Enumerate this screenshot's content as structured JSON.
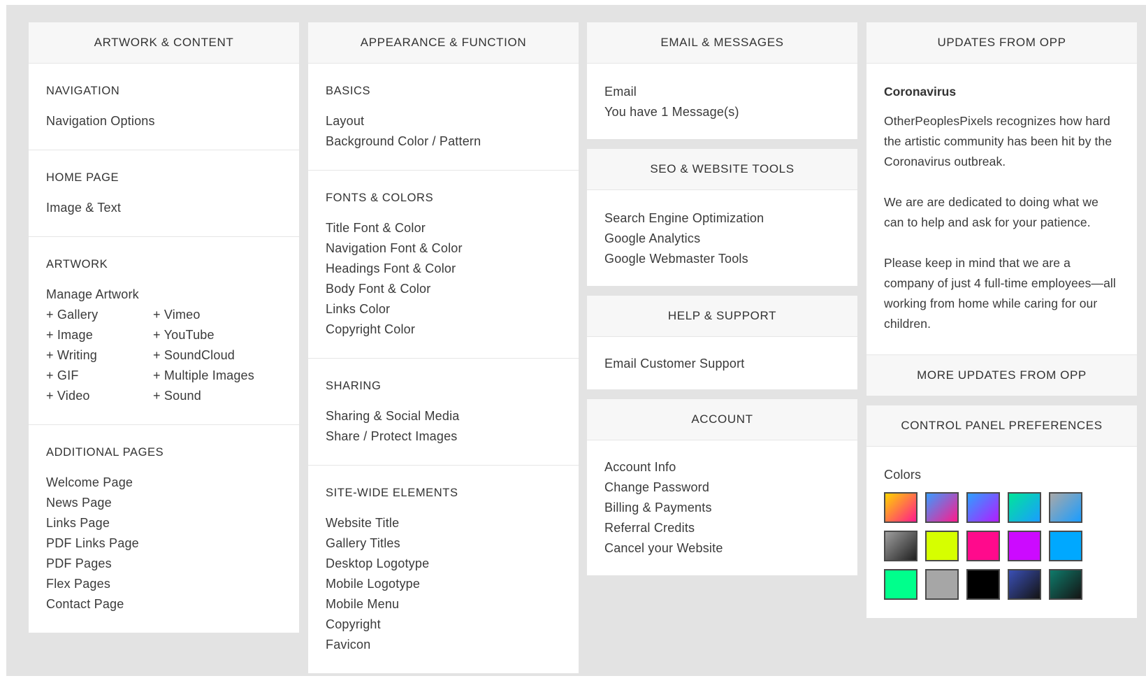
{
  "col1": {
    "header": "ARTWORK & CONTENT",
    "sections": [
      {
        "title": "NAVIGATION",
        "links": [
          "Navigation Options"
        ]
      },
      {
        "title": "HOME PAGE",
        "links": [
          "Image & Text"
        ]
      },
      {
        "title": "ARTWORK",
        "links": [
          "Manage Artwork"
        ],
        "add_left": [
          "+ Gallery",
          "+ Image",
          "+ Writing",
          "+ GIF",
          "+ Video"
        ],
        "add_right": [
          "+ Vimeo",
          "+ YouTube",
          "+ SoundCloud",
          "+ Multiple Images",
          "+ Sound"
        ]
      },
      {
        "title": "ADDITIONAL PAGES",
        "links": [
          "Welcome Page",
          "News Page",
          "Links Page",
          "PDF Links Page",
          "PDF Pages",
          "Flex Pages",
          "Contact Page"
        ]
      }
    ]
  },
  "col2": {
    "header": "APPEARANCE & FUNCTION",
    "sections": [
      {
        "title": "BASICS",
        "links": [
          "Layout",
          "Background Color / Pattern"
        ]
      },
      {
        "title": "FONTS & COLORS",
        "links": [
          "Title Font & Color",
          "Navigation Font & Color",
          "Headings Font & Color",
          "Body Font & Color",
          "Links Color",
          "Copyright Color"
        ]
      },
      {
        "title": "SHARING",
        "links": [
          "Sharing & Social Media",
          "Share / Protect Images"
        ]
      },
      {
        "title": "SITE-WIDE ELEMENTS",
        "links": [
          "Website Title",
          "Gallery Titles",
          "Desktop Logotype",
          "Mobile Logotype",
          "Mobile Menu",
          "Copyright",
          "Favicon"
        ]
      }
    ]
  },
  "col3": {
    "email": {
      "header": "EMAIL & MESSAGES",
      "link": "Email",
      "messages": "You have 1 Message(s)"
    },
    "seo": {
      "header": "SEO & WEBSITE TOOLS",
      "links": [
        "Search Engine Optimization",
        "Google Analytics",
        "Google Webmaster Tools"
      ]
    },
    "help": {
      "header": "HELP & SUPPORT",
      "links": [
        "Email Customer Support"
      ]
    },
    "account": {
      "header": "ACCOUNT",
      "links": [
        "Account Info",
        "Change Password",
        "Billing & Payments",
        "Referral Credits",
        "Cancel your Website"
      ]
    }
  },
  "col4": {
    "updates": {
      "header": "UPDATES FROM OPP",
      "title": "Coronavirus",
      "paragraphs": [
        "OtherPeoplesPixels recognizes how hard the artistic community has been hit by the Coronavirus outbreak.",
        "We are are dedicated to doing what we can to help and ask for your patience.",
        "Please keep in mind that we are a company of just 4 full-time employees—all working from home while caring for our children."
      ],
      "more": "MORE UPDATES FROM OPP"
    },
    "prefs": {
      "header": "CONTROL PANEL PREFERENCES",
      "colors_label": "Colors",
      "swatches": [
        "linear-gradient(135deg,#ffd400,#ff1a8c)",
        "linear-gradient(135deg,#3a9bff,#ff1a8c)",
        "linear-gradient(135deg,#2ea0ff,#b21dff)",
        "linear-gradient(135deg,#00e59a,#1a9dff)",
        "linear-gradient(135deg,#a8a8a8,#1a9dff)",
        "linear-gradient(135deg,#9e9e9e,#1f1f1f)",
        "#d6ff00",
        "#ff0a8c",
        "#cc0aff",
        "#00a8ff",
        "#00ff8c",
        "#a6a6a6",
        "#000000",
        "linear-gradient(135deg,#3a4fb5,#141414)",
        "linear-gradient(135deg,#0f7a6a,#141414)"
      ]
    }
  }
}
